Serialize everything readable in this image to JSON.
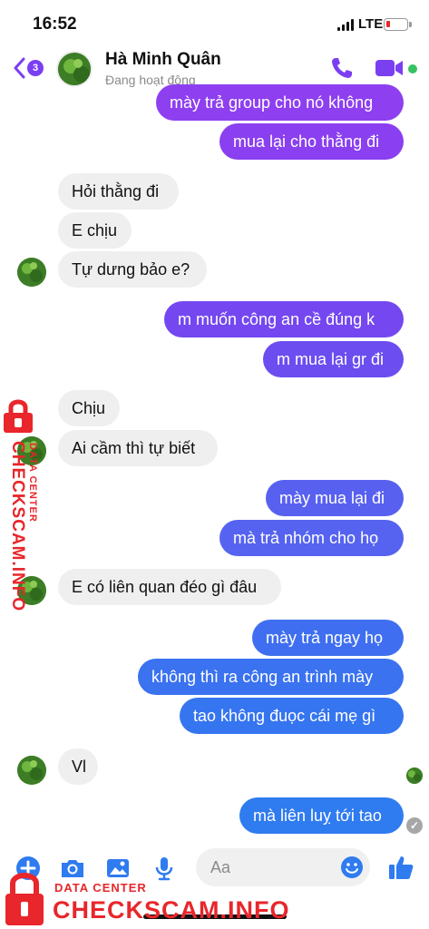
{
  "status_bar": {
    "time": "16:52",
    "network": "LTE",
    "battery_color": "#e8262b"
  },
  "header": {
    "back_count": "3",
    "contact_name": "Hà Minh Quân",
    "contact_status": "Đang hoạt động",
    "accent_color": "#7b3ff2",
    "icons": [
      "back-chevron-icon",
      "phone-icon",
      "video-camera-icon"
    ]
  },
  "messages": [
    {
      "side": "out",
      "text": "mày trả group cho nó không",
      "color": "#8e3ff0"
    },
    {
      "side": "out",
      "text": "mua lại cho thằng đi",
      "color": "#8a3ff0"
    },
    {
      "side": "in",
      "text": "Hỏi thằng đi"
    },
    {
      "side": "in",
      "text": "E chịu"
    },
    {
      "side": "in",
      "text": "Tự dưng bảo e?"
    },
    {
      "side": "out",
      "text": "m muốn công an cề đúng k",
      "color": "#7447f0"
    },
    {
      "side": "out",
      "text": "m mua lại gr đi",
      "color": "#6b4df0"
    },
    {
      "side": "in",
      "text": "Chịu"
    },
    {
      "side": "in",
      "text": "Ai cầm thì tự biết"
    },
    {
      "side": "out",
      "text": "mày mua lại đi",
      "color": "#5860f0"
    },
    {
      "side": "out",
      "text": "mà trả nhóm cho họ",
      "color": "#5563f0"
    },
    {
      "side": "in",
      "text": "E có liên quan đéo gì đâu"
    },
    {
      "side": "out",
      "text": "mày trả ngay họ",
      "color": "#3f6ff0"
    },
    {
      "side": "out",
      "text": "không thì ra công an trình mày",
      "color": "#3a72f0"
    },
    {
      "side": "out",
      "text": "tao không đuọc cái mẹ gì",
      "color": "#3675f0"
    },
    {
      "side": "in",
      "text": "Vl"
    },
    {
      "side": "out",
      "text": "mà liên luỵ tới tao",
      "color": "#2f7bf0"
    }
  ],
  "composer": {
    "placeholder": "Aa",
    "icon_color": "#2f7bf0",
    "icons": [
      "plus-icon",
      "camera-icon",
      "image-icon",
      "microphone-icon",
      "emoji-icon",
      "thumbs-up-icon"
    ]
  },
  "watermark": {
    "brand": "CHECKSCAM.INFO",
    "sub": "DATA CENTER",
    "color": "#e8262b"
  }
}
